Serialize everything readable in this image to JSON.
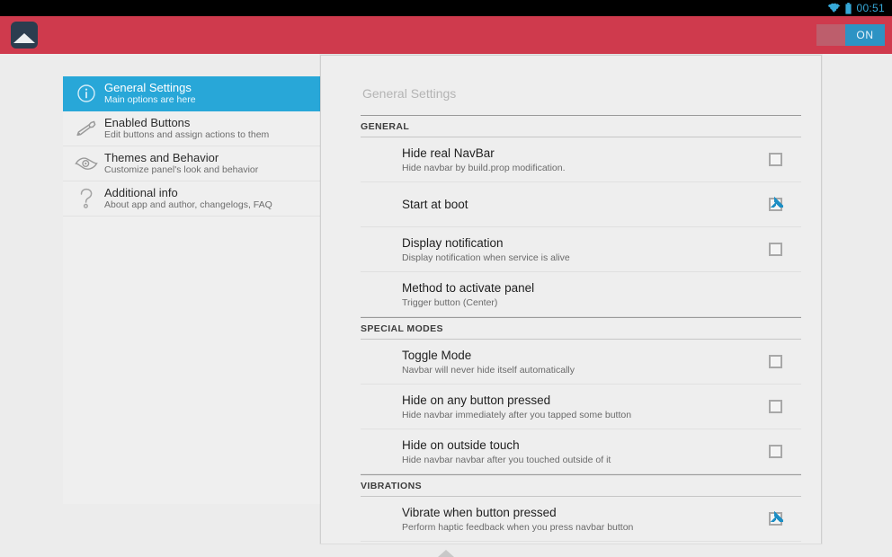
{
  "status_bar": {
    "time": "00:51",
    "wifi_icon": "wifi-icon",
    "battery_icon": "battery-icon",
    "accent_color": "#36a8d8",
    "background_color": "#000000"
  },
  "action_bar": {
    "background_color": "#cf3a4d",
    "logo_icon": "app-logo-icon",
    "master_switch": {
      "label": "ON",
      "state": "on",
      "track_color": "#bd5e6c",
      "thumb_color": "#2d93c4"
    }
  },
  "sidebar": {
    "selected_index": 0,
    "selected_color": "#28a7d8",
    "items": [
      {
        "icon": "info-circle-icon",
        "title": "General Settings",
        "subtitle": "Main options are here"
      },
      {
        "icon": "wrench-icon",
        "title": "Enabled Buttons",
        "subtitle": "Edit buttons and assign actions to them"
      },
      {
        "icon": "eye-icon",
        "title": "Themes and Behavior",
        "subtitle": "Customize panel's look and behavior"
      },
      {
        "icon": "question-mark-icon",
        "title": "Additional info",
        "subtitle": "About app and author, changelogs, FAQ"
      }
    ]
  },
  "panel": {
    "title": "General Settings",
    "sections": [
      {
        "header": "GENERAL",
        "rows": [
          {
            "title": "Hide real NavBar",
            "subtitle": "Hide navbar by build.prop modification.",
            "control": "checkbox",
            "checked": false
          },
          {
            "title": "Start at boot",
            "subtitle": "",
            "control": "checkbox",
            "checked": true
          },
          {
            "title": "Display notification",
            "subtitle": "Display notification when service is alive",
            "control": "checkbox",
            "checked": false
          },
          {
            "title": "Method to activate panel",
            "subtitle": "Trigger button (Center)",
            "control": "none",
            "checked": false
          }
        ]
      },
      {
        "header": "SPECIAL MODES",
        "rows": [
          {
            "title": "Toggle Mode",
            "subtitle": "Navbar will never hide itself automatically",
            "control": "checkbox",
            "checked": false
          },
          {
            "title": "Hide on any button pressed",
            "subtitle": "Hide navbar immediately after you tapped some button",
            "control": "checkbox",
            "checked": false
          },
          {
            "title": "Hide on outside touch",
            "subtitle": "Hide navbar navbar after you touched outside of it",
            "control": "checkbox",
            "checked": false
          }
        ]
      },
      {
        "header": "VIBRATIONS",
        "rows": [
          {
            "title": "Vibrate when button pressed",
            "subtitle": "Perform haptic feedback when you press navbar button",
            "control": "checkbox",
            "checked": true
          }
        ]
      }
    ]
  },
  "nav_handle": {
    "icon": "nav-up-triangle-icon"
  }
}
